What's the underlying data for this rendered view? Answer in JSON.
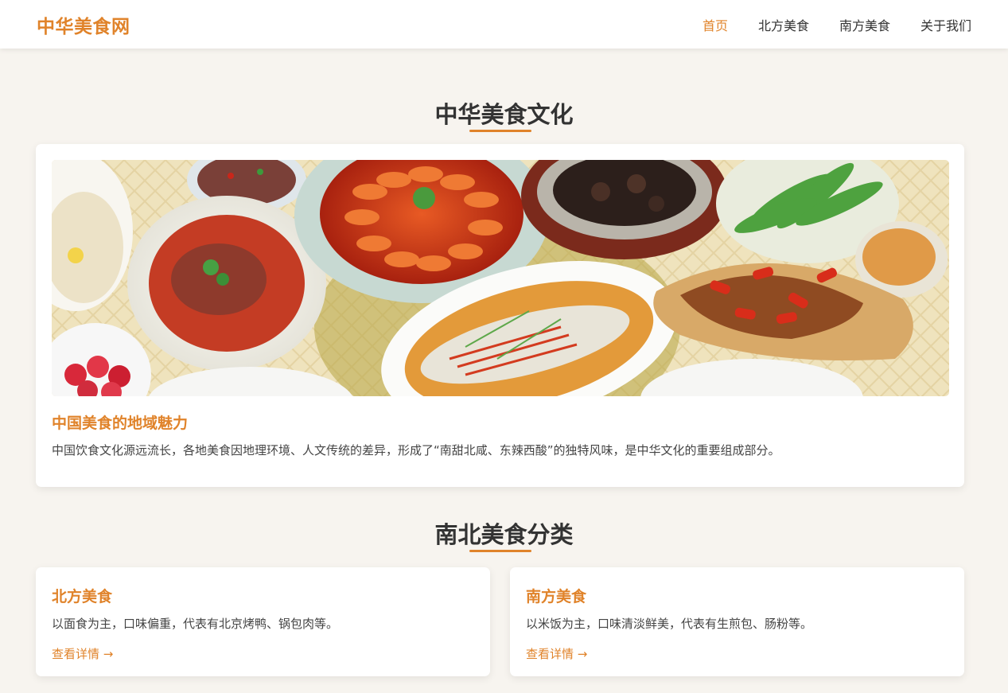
{
  "brand": {
    "logo": "中华美食网",
    "accent": "#e0832a"
  },
  "nav": {
    "items": [
      {
        "label": "首页",
        "active": true
      },
      {
        "label": "北方美食",
        "active": false
      },
      {
        "label": "南方美食",
        "active": false
      },
      {
        "label": "关于我们",
        "active": false
      }
    ]
  },
  "culture": {
    "title": "中华美食文化",
    "card": {
      "heading": "中国美食的地域魅力",
      "text": "中国饮食文化源远流长，各地美食因地理环境、人文传统的差异，形成了“南甜北咸、东辣西酸”的独特风味，是中华文化的重要组成部分。"
    }
  },
  "categories": {
    "title": "南北美食分类",
    "north": {
      "heading": "北方美食",
      "text": "以面食为主，口味偏重，代表有北京烤鸭、锅包肉等。",
      "link": "查看详情 →"
    },
    "south": {
      "heading": "南方美食",
      "text": "以米饭为主，口味清淡鲜美，代表有生煎包、肠粉等。",
      "link": "查看详情 →"
    }
  }
}
